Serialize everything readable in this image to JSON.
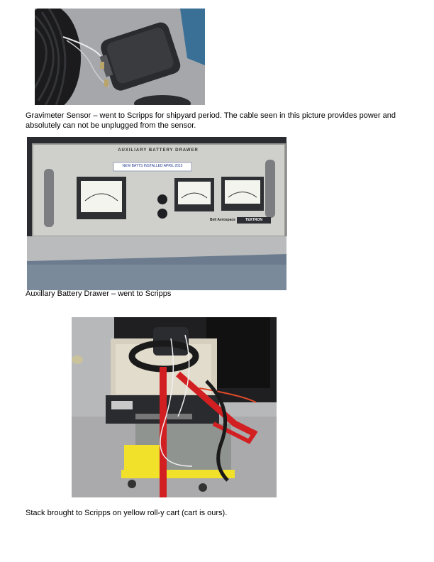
{
  "captions": {
    "gravimeter": "Gravimeter Sensor – went to Scripps for shipyard period.  The cable seen in this picture provides power and absolutely can not be unplugged from the sensor.",
    "battery_drawer": "Auxillary Battery Drawer – went to Scripps",
    "stack": "Stack brought to Scripps on yellow roll-y cart (cart is ours)."
  },
  "battery_panel": {
    "title": "AUXILIARY BATTERY DRAWER",
    "sticker": "NEW BATTS INSTALLED APRIL 2015",
    "brand": "Bell Aerospace",
    "brand_box": "TEXTRON"
  }
}
